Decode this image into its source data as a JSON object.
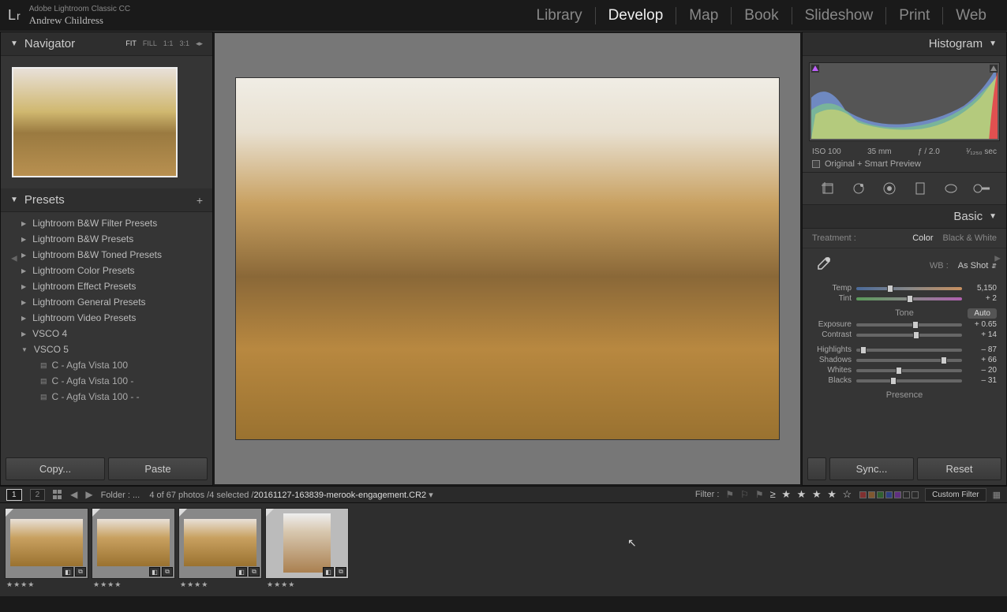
{
  "app": {
    "name": "Adobe Lightroom Classic CC",
    "user": "Andrew Childress",
    "logo": "Lr"
  },
  "modules": [
    "Library",
    "Develop",
    "Map",
    "Book",
    "Slideshow",
    "Print",
    "Web"
  ],
  "active_module": "Develop",
  "navigator": {
    "title": "Navigator",
    "zoom_levels": [
      "FIT",
      "FILL",
      "1:1",
      "3:1"
    ],
    "active_zoom": "FIT"
  },
  "presets": {
    "title": "Presets",
    "folders": [
      {
        "label": "Lightroom B&W Filter Presets",
        "open": false
      },
      {
        "label": "Lightroom B&W Presets",
        "open": false
      },
      {
        "label": "Lightroom B&W Toned Presets",
        "open": false
      },
      {
        "label": "Lightroom Color Presets",
        "open": false
      },
      {
        "label": "Lightroom Effect Presets",
        "open": false
      },
      {
        "label": "Lightroom General Presets",
        "open": false
      },
      {
        "label": "Lightroom Video Presets",
        "open": false
      },
      {
        "label": "VSCO 4",
        "open": false
      },
      {
        "label": "VSCO 5",
        "open": true,
        "items": [
          "C - Agfa Vista 100",
          "C - Agfa Vista 100 -",
          "C - Agfa Vista 100 - -"
        ]
      }
    ]
  },
  "left_buttons": {
    "copy": "Copy...",
    "paste": "Paste"
  },
  "right_buttons": {
    "sync": "Sync...",
    "reset": "Reset"
  },
  "histogram": {
    "title": "Histogram",
    "iso": "ISO 100",
    "focal": "35 mm",
    "aperture": "ƒ / 2.0",
    "shutter": "¹⁄₁₂₅₀ sec",
    "preview_mode": "Original + Smart Preview"
  },
  "basic": {
    "title": "Basic",
    "treatment_label": "Treatment :",
    "treatment_options": [
      "Color",
      "Black & White"
    ],
    "treatment_active": "Color",
    "wb_label": "WB :",
    "wb_value": "As Shot",
    "temp_label": "Temp",
    "temp_value": "5,150",
    "tint_label": "Tint",
    "tint_value": "+ 2",
    "tone_label": "Tone",
    "auto_label": "Auto",
    "exposure_label": "Exposure",
    "exposure_value": "+ 0.65",
    "contrast_label": "Contrast",
    "contrast_value": "+ 14",
    "highlights_label": "Highlights",
    "highlights_value": "– 87",
    "shadows_label": "Shadows",
    "shadows_value": "+ 66",
    "whites_label": "Whites",
    "whites_value": "– 20",
    "blacks_label": "Blacks",
    "blacks_value": "– 31",
    "presence_label": "Presence"
  },
  "info_bar": {
    "folder_label": "Folder :",
    "folder_handle": "...",
    "count": "4 of 67 photos /4 selected /",
    "filename": "20161127-163839-merook-engagement.CR2",
    "filter_label": "Filter :",
    "stars": "≥ ★ ★ ★ ★ ☆",
    "custom_filter": "Custom Filter"
  },
  "filmstrip": {
    "thumbs": [
      {
        "selected": true,
        "stars": "★★★★"
      },
      {
        "selected": true,
        "stars": "★★★★"
      },
      {
        "selected": true,
        "stars": "★★★★"
      },
      {
        "selected": true,
        "stars": "★★★★",
        "light": true
      }
    ]
  }
}
